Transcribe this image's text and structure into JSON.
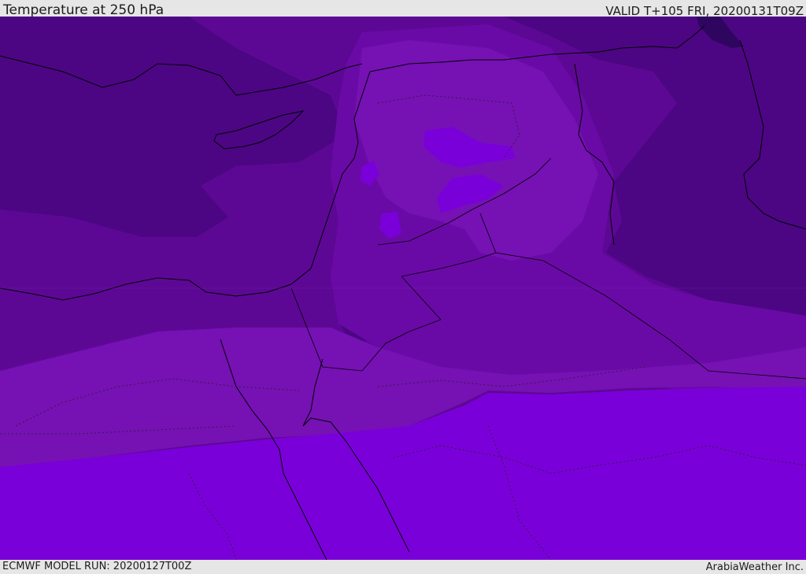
{
  "header": {
    "title": "Temperature at 250 hPa",
    "valid_time": "VALID T+105 FRI, 20200131T09Z"
  },
  "footer": {
    "model_run": "ECMWF MODEL RUN: 20200127T00Z",
    "credit": "ArabiaWeather Inc."
  },
  "colors": {
    "background": "#e6e6e6",
    "coldest": "#2e0660",
    "very_cold": "#4c0683",
    "cold": "#5d0895",
    "cool": "#6a0aa6",
    "mild": "#7611b4",
    "warm": "#7a00d9",
    "warmer": "#8018e8",
    "coastline": "#000000"
  }
}
